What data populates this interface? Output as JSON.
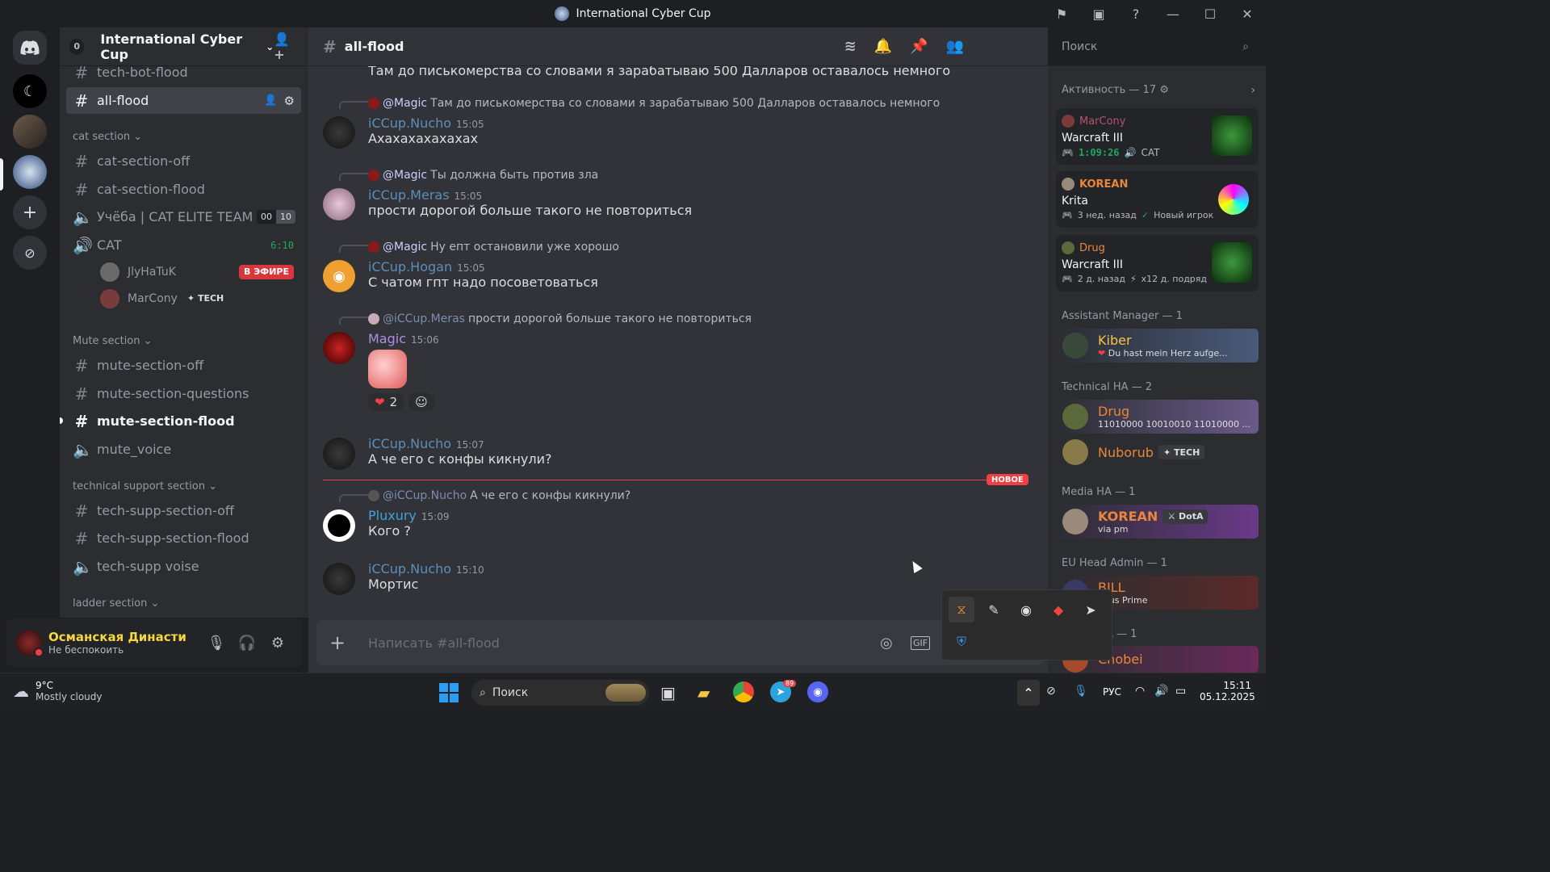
{
  "window": {
    "title": "International Cyber Cup"
  },
  "server": {
    "name": "International Cyber Cup",
    "unread": "0"
  },
  "sidebar": {
    "channels_top": [
      {
        "name": "tech-bot-flood",
        "type": "text"
      },
      {
        "name": "all-flood",
        "type": "text",
        "active": true
      }
    ],
    "cat_section": {
      "label": "cat section"
    },
    "cat_channels": [
      {
        "name": "cat-section-off"
      },
      {
        "name": "cat-section-flood"
      }
    ],
    "voice_ucheba": {
      "name": "Учёба | CAT ELITE TEAM",
      "count1": "00",
      "count2": "10"
    },
    "voice_cat": {
      "name": "CAT",
      "time": "6:10"
    },
    "voice_users": [
      {
        "name": "JlyHaTuK",
        "badge": "В ЭФИРЕ"
      },
      {
        "name": "MarCony",
        "tag": "TECH"
      }
    ],
    "mute_section": {
      "label": "Mute section"
    },
    "mute_channels": [
      {
        "name": "mute-section-off"
      },
      {
        "name": "mute-section-questions"
      },
      {
        "name": "mute-section-flood"
      },
      {
        "name": "mute_voice"
      }
    ],
    "tech_section": {
      "label": "technical support section"
    },
    "tech_channels": [
      {
        "name": "tech-supp-section-off"
      },
      {
        "name": "tech-supp-section-flood"
      },
      {
        "name": "tech-supp voise"
      }
    ],
    "ladder_section": {
      "label": "ladder section"
    }
  },
  "user": {
    "name": "Османская Династия",
    "status": "Не беспокоить"
  },
  "channel": {
    "name": "all-flood",
    "search_placeholder": "Поиск"
  },
  "messages": {
    "top_text": "Там до писькомерства со словами я зарабатываю 500 Далларов оставалось немного",
    "m1": {
      "reply_to": "@Magic",
      "reply_text": "Там до писькомерства со словами я зарабатываю 500 Далларов оставалось немного",
      "author": "iCCup.Nucho",
      "time": "15:05",
      "text": "Ахахахахахахах"
    },
    "m2": {
      "reply_to": "@Magic",
      "reply_text": "Ты должна быть против зла",
      "author": "iCCup.Meras",
      "time": "15:05",
      "text": "прости дорогой больше такого не повториться"
    },
    "m3": {
      "reply_to": "@Magic",
      "reply_text": "Ну епт остановили уже хорошо",
      "author": "iCCup.Hogan",
      "time": "15:05",
      "text": "С чатом гпт надо посоветоваться"
    },
    "m4": {
      "reply_to": "@iCCup.Meras",
      "reply_text": "прости дорогой больше такого не повториться",
      "author": "Magic",
      "time": "15:06",
      "reaction_count": "2"
    },
    "m5": {
      "author": "iCCup.Nucho",
      "time": "15:07",
      "text": "А че его с конфы кикнули?"
    },
    "new_label": "НОВОЕ",
    "m6": {
      "reply_to": "@iCCup.Nucho",
      "reply_text": "А че его с конфы кикнули?",
      "author": "Pluxury",
      "time": "15:09",
      "text": "Кого ?"
    },
    "m7": {
      "author": "iCCup.Nucho",
      "time": "15:10",
      "text": "Мортис"
    }
  },
  "composer": {
    "placeholder": "Написать #all-flood"
  },
  "members": {
    "activity_header": "Активность — 17",
    "activities": [
      {
        "user": "MarCony",
        "game": "Warcraft III",
        "timer": "1:09:26",
        "extra": "CAT"
      },
      {
        "user": "KOREAN",
        "game": "Krita",
        "line1": "3 нед. назад",
        "line2": "Новый игрок"
      },
      {
        "user": "Drug",
        "game": "Warcraft III",
        "line1": "2 д. назад",
        "line2": "x12 д. подряд"
      }
    ],
    "groups": [
      {
        "title": "Assistant Manager — 1",
        "members": [
          {
            "name": "Kiber",
            "status": "Du hast mein Herz aufge..."
          }
        ]
      },
      {
        "title": "Technical HA — 2",
        "members": [
          {
            "name": "Drug",
            "status": "11010000 10010010 11010000 ..."
          },
          {
            "name": "Nuborub",
            "tag": "TECH"
          }
        ]
      },
      {
        "title": "Media HA — 1",
        "members": [
          {
            "name": "KOREAN",
            "tag": "DotA",
            "status": "via pm"
          }
        ]
      },
      {
        "title": "EU Head Admin — 1",
        "members": [
          {
            "name": "BILL",
            "status": "imus Prime"
          }
        ]
      },
      {
        "title": "A — 1",
        "members": [
          {
            "name": "Chobei"
          }
        ]
      }
    ]
  },
  "taskbar": {
    "weather_temp": "9°C",
    "weather_desc": "Mostly cloudy",
    "search": "Поиск",
    "lang": "РУС",
    "time": "15:11",
    "date": "05.12.2025",
    "telegram_badge": "89"
  }
}
